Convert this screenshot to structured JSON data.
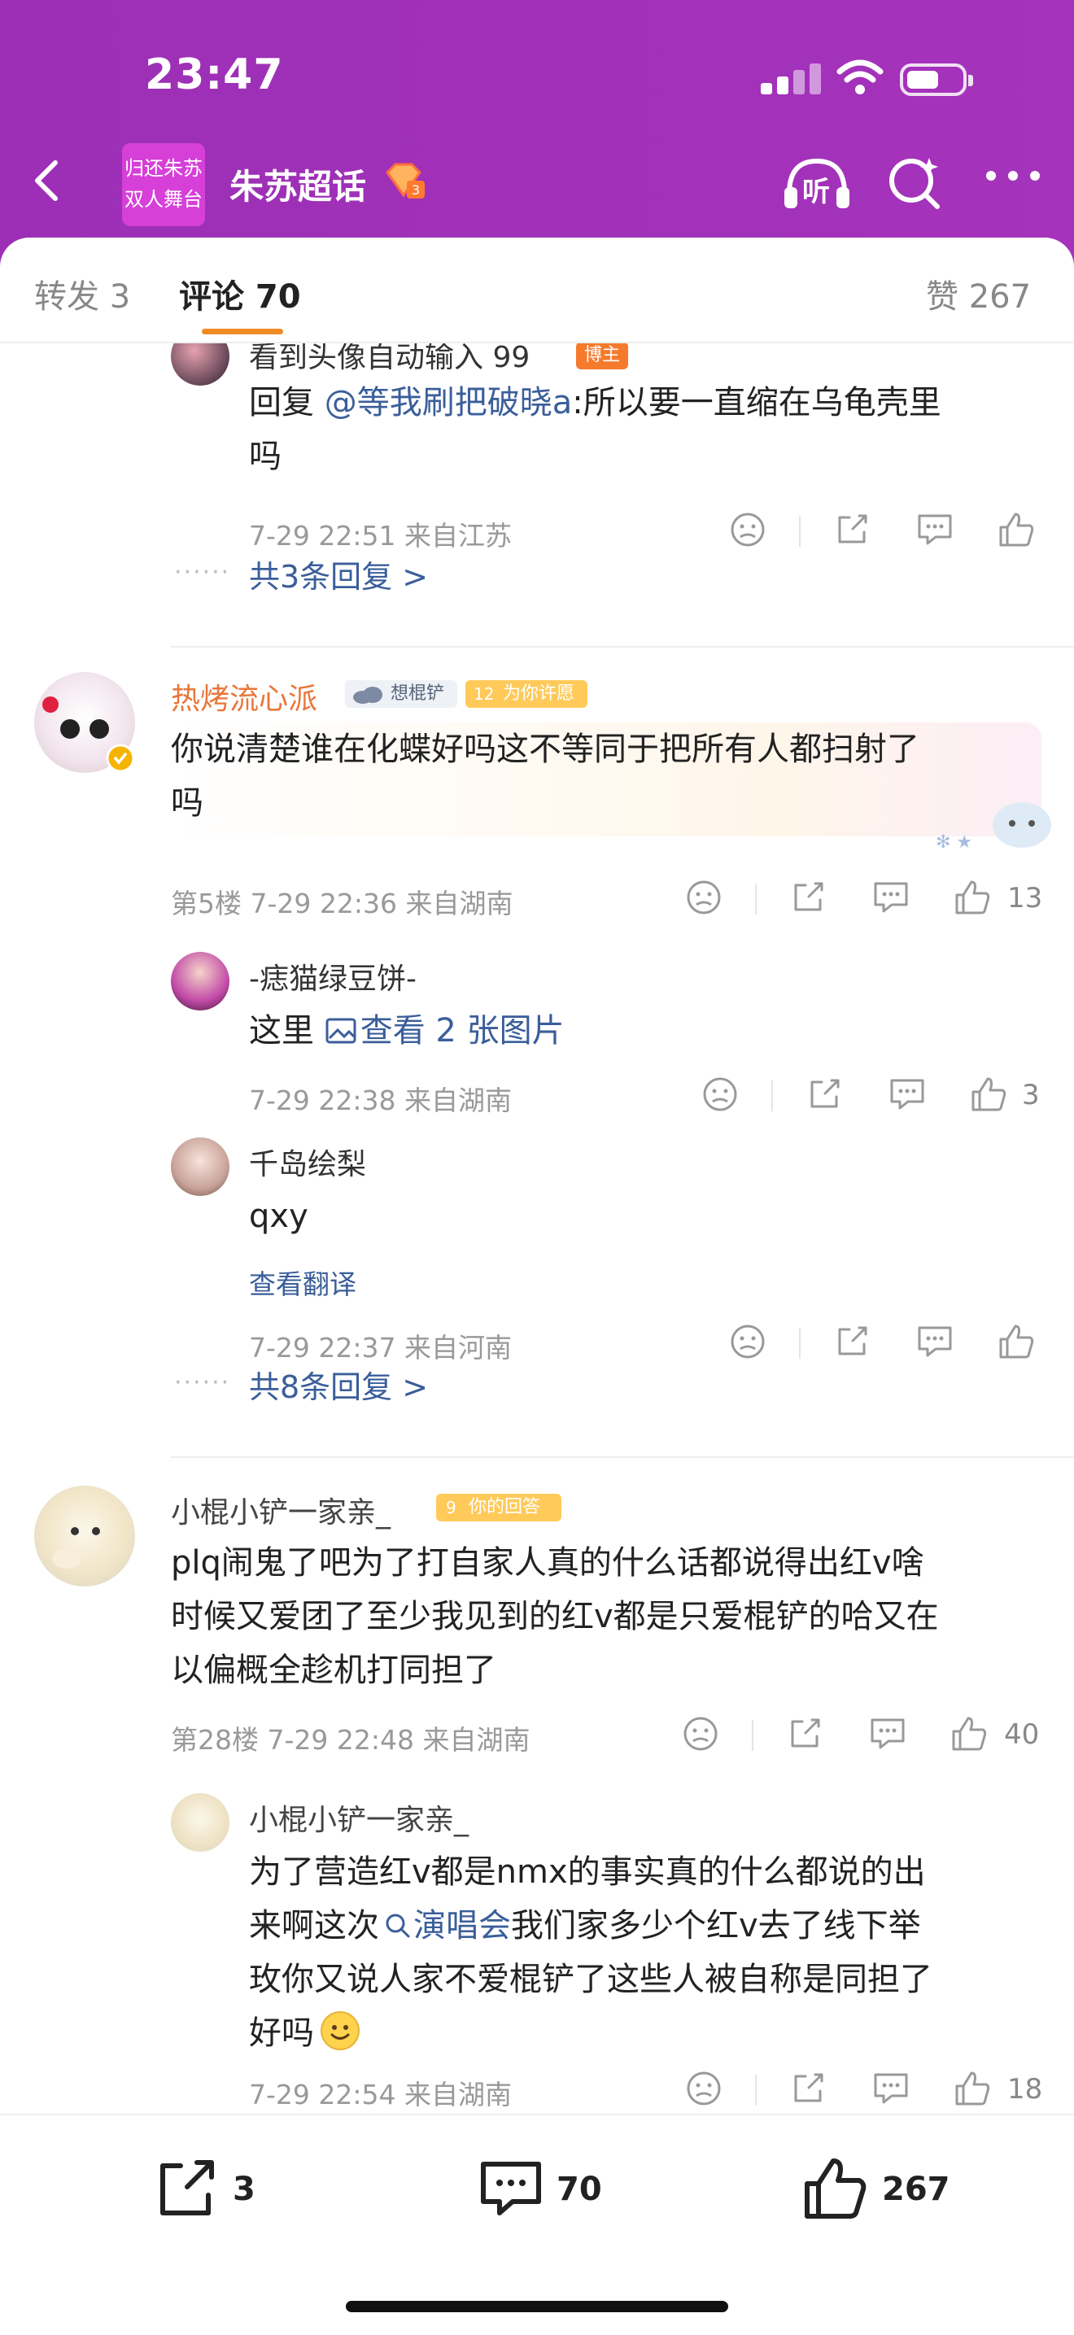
{
  "status_bar": {
    "time": "23:47"
  },
  "nav": {
    "title": "朱苏超话",
    "logo_line1": "归还朱苏",
    "logo_line2": "双人舞台",
    "listen_label": "听"
  },
  "tabs": {
    "repost": "转发 3",
    "comments": "评论 70",
    "likes": "赞 267"
  },
  "comments": [
    {
      "user": "看到头像自动输入 99",
      "badge": "博主",
      "reply_prefix": "回复 ",
      "mention": "@等我刷把破晓a",
      "text_line1": ":所以要一直缩在乌龟壳里",
      "text_line2": "吗",
      "meta": "7-29 22:51 来自江苏",
      "more_replies": "共3条回复 >"
    },
    {
      "user": "热烤流心派",
      "badge1": "想棍铲",
      "badge2_level": "12",
      "badge2": "为你许愿",
      "text_line1": "你说清楚谁在化蝶好吗这不等同于把所有人都扫射了",
      "text_line2": "吗",
      "meta": "第5楼 7-29 22:36 来自湖南",
      "like_count": "13",
      "replies": [
        {
          "user": "-痣猫绿豆饼-",
          "text": "这里 ",
          "pic_link": "查看 2 张图片",
          "meta": "7-29 22:38 来自湖南",
          "like_count": "3"
        },
        {
          "user": "千岛绘梨",
          "text": "qxy",
          "translate": "查看翻译",
          "meta": "7-29 22:37 来自河南",
          "like_count": ""
        }
      ],
      "more_replies": "共8条回复 >"
    },
    {
      "user": "小棍小铲一家亲_",
      "badge_level": "9",
      "badge": "你的回答",
      "text_line1": "plq闹鬼了吧为了打自家人真的什么话都说得出红v啥",
      "text_line2": "时候又爱团了至少我见到的红v都是只爱棍铲的哈又在",
      "text_line3": "以偏概全趁机打同担了",
      "meta": "第28楼 7-29 22:48 来自湖南",
      "like_count": "40",
      "reply": {
        "user": "小棍小铲一家亲_",
        "line1": "为了营造红v都是nmx的事实真的什么都说的出",
        "line2_pre": "来啊这次",
        "line2_link": "演唱会",
        "line2_post": "我们家多少个红v去了线下举",
        "line3": "玫你又说人家不爱棍铲了这些人被自称是同担了",
        "line4": "好吗",
        "meta": "7-29 22:54 来自湖南",
        "like_count": "18"
      }
    }
  ],
  "bottom_bar": {
    "repost_count": "3",
    "comment_count": "70",
    "like_count": "267"
  },
  "colors": {
    "header_purple": "#a033b8",
    "link_blue": "#3a5e9a",
    "username_orange": "#e8763a",
    "tab_indicator": "#f08a24"
  }
}
